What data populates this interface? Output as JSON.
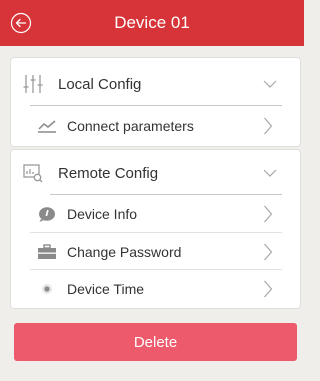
{
  "header": {
    "title": "Device 01",
    "back_icon": "back-arrow-circle-icon",
    "background": "#d63438"
  },
  "local_config": {
    "label": "Local Config",
    "icon": "sliders-icon",
    "items": [
      {
        "label": "Connect parameters",
        "icon": "line-chart-icon"
      }
    ]
  },
  "remote_config": {
    "label": "Remote Config",
    "icon": "monitor-search-icon",
    "items": [
      {
        "label": "Device Info",
        "icon": "info-bubble-icon"
      },
      {
        "label": "Change Password",
        "icon": "toolbox-icon"
      },
      {
        "label": "Device Time",
        "icon": "clock-dot-icon"
      }
    ]
  },
  "delete_button": {
    "label": "Delete",
    "color": "#ed5a6b"
  }
}
